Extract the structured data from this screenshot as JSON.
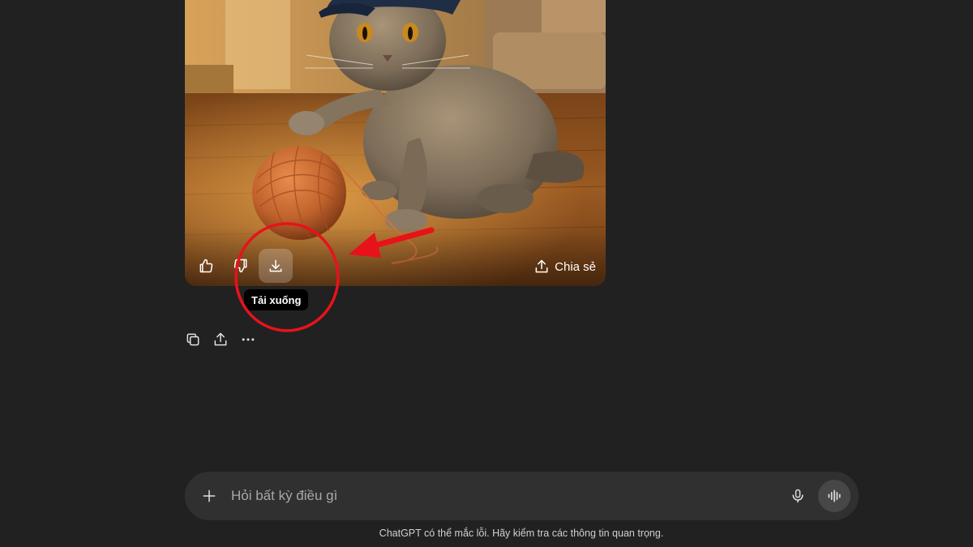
{
  "image": {
    "alt": "",
    "share_label": "Chia sẻ",
    "buttons": {
      "like_icon": "thumbs-up-icon",
      "dislike_icon": "thumbs-down-icon",
      "download_icon": "download-icon"
    }
  },
  "tooltip": {
    "download_text": "Tải xuống"
  },
  "message_actions": {
    "copy_icon": "copy-icon",
    "share_icon": "share-icon",
    "more_icon": "more-icon"
  },
  "composer": {
    "placeholder": "Hỏi bất kỳ điều gì",
    "value": ""
  },
  "disclaimer": "ChatGPT có thể mắc lỗi. Hãy kiểm tra các thông tin quan trọng.",
  "colors": {
    "background": "#212121",
    "composer": "#303030",
    "annotation": "#e8121b",
    "tooltip": "#000000"
  }
}
